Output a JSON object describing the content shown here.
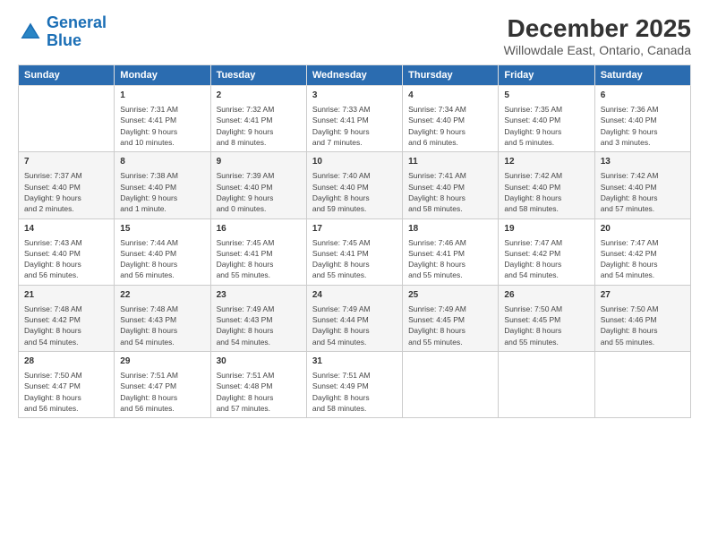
{
  "logo": {
    "line1": "General",
    "line2": "Blue"
  },
  "title": "December 2025",
  "subtitle": "Willowdale East, Ontario, Canada",
  "header": {
    "days": [
      "Sunday",
      "Monday",
      "Tuesday",
      "Wednesday",
      "Thursday",
      "Friday",
      "Saturday"
    ]
  },
  "weeks": [
    [
      {
        "day": "",
        "info": ""
      },
      {
        "day": "1",
        "info": "Sunrise: 7:31 AM\nSunset: 4:41 PM\nDaylight: 9 hours\nand 10 minutes."
      },
      {
        "day": "2",
        "info": "Sunrise: 7:32 AM\nSunset: 4:41 PM\nDaylight: 9 hours\nand 8 minutes."
      },
      {
        "day": "3",
        "info": "Sunrise: 7:33 AM\nSunset: 4:41 PM\nDaylight: 9 hours\nand 7 minutes."
      },
      {
        "day": "4",
        "info": "Sunrise: 7:34 AM\nSunset: 4:40 PM\nDaylight: 9 hours\nand 6 minutes."
      },
      {
        "day": "5",
        "info": "Sunrise: 7:35 AM\nSunset: 4:40 PM\nDaylight: 9 hours\nand 5 minutes."
      },
      {
        "day": "6",
        "info": "Sunrise: 7:36 AM\nSunset: 4:40 PM\nDaylight: 9 hours\nand 3 minutes."
      }
    ],
    [
      {
        "day": "7",
        "info": "Sunrise: 7:37 AM\nSunset: 4:40 PM\nDaylight: 9 hours\nand 2 minutes."
      },
      {
        "day": "8",
        "info": "Sunrise: 7:38 AM\nSunset: 4:40 PM\nDaylight: 9 hours\nand 1 minute."
      },
      {
        "day": "9",
        "info": "Sunrise: 7:39 AM\nSunset: 4:40 PM\nDaylight: 9 hours\nand 0 minutes."
      },
      {
        "day": "10",
        "info": "Sunrise: 7:40 AM\nSunset: 4:40 PM\nDaylight: 8 hours\nand 59 minutes."
      },
      {
        "day": "11",
        "info": "Sunrise: 7:41 AM\nSunset: 4:40 PM\nDaylight: 8 hours\nand 58 minutes."
      },
      {
        "day": "12",
        "info": "Sunrise: 7:42 AM\nSunset: 4:40 PM\nDaylight: 8 hours\nand 58 minutes."
      },
      {
        "day": "13",
        "info": "Sunrise: 7:42 AM\nSunset: 4:40 PM\nDaylight: 8 hours\nand 57 minutes."
      }
    ],
    [
      {
        "day": "14",
        "info": "Sunrise: 7:43 AM\nSunset: 4:40 PM\nDaylight: 8 hours\nand 56 minutes."
      },
      {
        "day": "15",
        "info": "Sunrise: 7:44 AM\nSunset: 4:40 PM\nDaylight: 8 hours\nand 56 minutes."
      },
      {
        "day": "16",
        "info": "Sunrise: 7:45 AM\nSunset: 4:41 PM\nDaylight: 8 hours\nand 55 minutes."
      },
      {
        "day": "17",
        "info": "Sunrise: 7:45 AM\nSunset: 4:41 PM\nDaylight: 8 hours\nand 55 minutes."
      },
      {
        "day": "18",
        "info": "Sunrise: 7:46 AM\nSunset: 4:41 PM\nDaylight: 8 hours\nand 55 minutes."
      },
      {
        "day": "19",
        "info": "Sunrise: 7:47 AM\nSunset: 4:42 PM\nDaylight: 8 hours\nand 54 minutes."
      },
      {
        "day": "20",
        "info": "Sunrise: 7:47 AM\nSunset: 4:42 PM\nDaylight: 8 hours\nand 54 minutes."
      }
    ],
    [
      {
        "day": "21",
        "info": "Sunrise: 7:48 AM\nSunset: 4:42 PM\nDaylight: 8 hours\nand 54 minutes."
      },
      {
        "day": "22",
        "info": "Sunrise: 7:48 AM\nSunset: 4:43 PM\nDaylight: 8 hours\nand 54 minutes."
      },
      {
        "day": "23",
        "info": "Sunrise: 7:49 AM\nSunset: 4:43 PM\nDaylight: 8 hours\nand 54 minutes."
      },
      {
        "day": "24",
        "info": "Sunrise: 7:49 AM\nSunset: 4:44 PM\nDaylight: 8 hours\nand 54 minutes."
      },
      {
        "day": "25",
        "info": "Sunrise: 7:49 AM\nSunset: 4:45 PM\nDaylight: 8 hours\nand 55 minutes."
      },
      {
        "day": "26",
        "info": "Sunrise: 7:50 AM\nSunset: 4:45 PM\nDaylight: 8 hours\nand 55 minutes."
      },
      {
        "day": "27",
        "info": "Sunrise: 7:50 AM\nSunset: 4:46 PM\nDaylight: 8 hours\nand 55 minutes."
      }
    ],
    [
      {
        "day": "28",
        "info": "Sunrise: 7:50 AM\nSunset: 4:47 PM\nDaylight: 8 hours\nand 56 minutes."
      },
      {
        "day": "29",
        "info": "Sunrise: 7:51 AM\nSunset: 4:47 PM\nDaylight: 8 hours\nand 56 minutes."
      },
      {
        "day": "30",
        "info": "Sunrise: 7:51 AM\nSunset: 4:48 PM\nDaylight: 8 hours\nand 57 minutes."
      },
      {
        "day": "31",
        "info": "Sunrise: 7:51 AM\nSunset: 4:49 PM\nDaylight: 8 hours\nand 58 minutes."
      },
      {
        "day": "",
        "info": ""
      },
      {
        "day": "",
        "info": ""
      },
      {
        "day": "",
        "info": ""
      }
    ]
  ]
}
